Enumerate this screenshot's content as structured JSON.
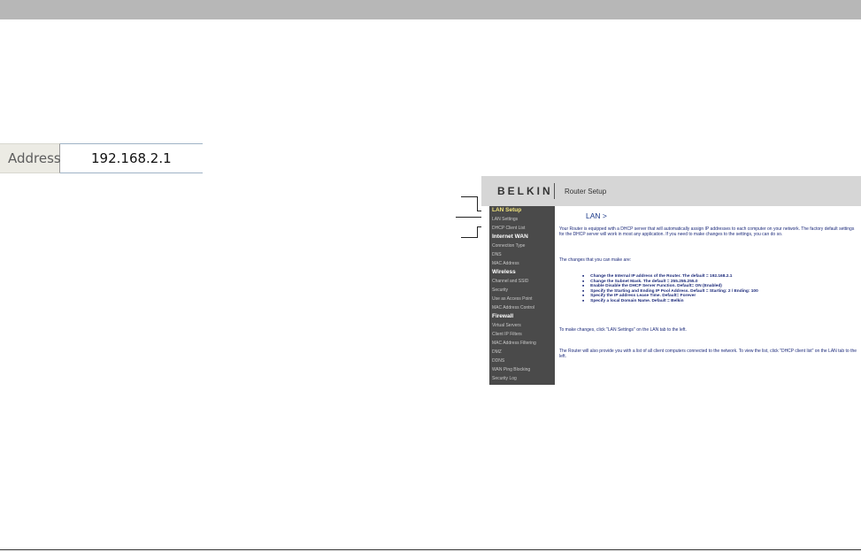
{
  "address_bar": {
    "label": "Address",
    "value": "192.168.2.1"
  },
  "router": {
    "brand": "BELKIN",
    "header_title": "Router Setup",
    "nav": [
      {
        "label": "LAN Setup",
        "kind": "section",
        "highlight": true
      },
      {
        "label": "LAN Settings",
        "kind": "item"
      },
      {
        "label": "DHCP Client List",
        "kind": "item"
      },
      {
        "label": "Internet WAN",
        "kind": "section"
      },
      {
        "label": "Connection Type",
        "kind": "item"
      },
      {
        "label": "DNS",
        "kind": "item"
      },
      {
        "label": "MAC Address",
        "kind": "item"
      },
      {
        "label": "Wireless",
        "kind": "section"
      },
      {
        "label": "Channel and SSID",
        "kind": "item"
      },
      {
        "label": "Security",
        "kind": "item"
      },
      {
        "label": "Use as Access Point",
        "kind": "item"
      },
      {
        "label": "MAC Address Control",
        "kind": "item"
      },
      {
        "label": "Firewall",
        "kind": "section"
      },
      {
        "label": "Virtual Servers",
        "kind": "item"
      },
      {
        "label": "Client IP Filters",
        "kind": "item"
      },
      {
        "label": "MAC Address Filtering",
        "kind": "item"
      },
      {
        "label": "DMZ",
        "kind": "item"
      },
      {
        "label": "DDNS",
        "kind": "item"
      },
      {
        "label": "WAN Ping Blocking",
        "kind": "item"
      },
      {
        "label": "Security Log",
        "kind": "item"
      }
    ],
    "main": {
      "title": "LAN >",
      "intro": "Your Router is equipped with a DHCP server that will automatically assign IP addresses to each computer on your network. The factory default settings for the DHCP server will work in most any application. If you need to make changes to the settings, you can do so.",
      "changes_heading": "The changes that you can make are:",
      "changes": [
        "Change the Internal IP address of the Router. The default = 192.168.2.1",
        "Change the Subnet Mask. The default = 255.255.255.0",
        "Enable Disable the DHCP Server Function. Default= ON (Enabled)",
        "Specify the Starting and Ending IP Pool Address. Default = Starting: 2 / Ending: 100",
        "Specify the IP address Lease Time. Default= Forever",
        "Specify a local Domain Name. Default = Belkin"
      ],
      "make_changes": "To make changes, click \"LAN Settings\" on the LAN tab to the left.",
      "client_list_note": "The Router will also provide you with a list of all client computers connected to the network. To view the list, click \"DHCP client list\" on the LAN tab to the left."
    }
  },
  "colors": {
    "top_bar": "#b7b7b7",
    "nav_bg": "#4a4a4a",
    "nav_highlight": "#f0e27a",
    "header_bg": "#d6d6d6",
    "link_blue": "#1c2a7a"
  }
}
